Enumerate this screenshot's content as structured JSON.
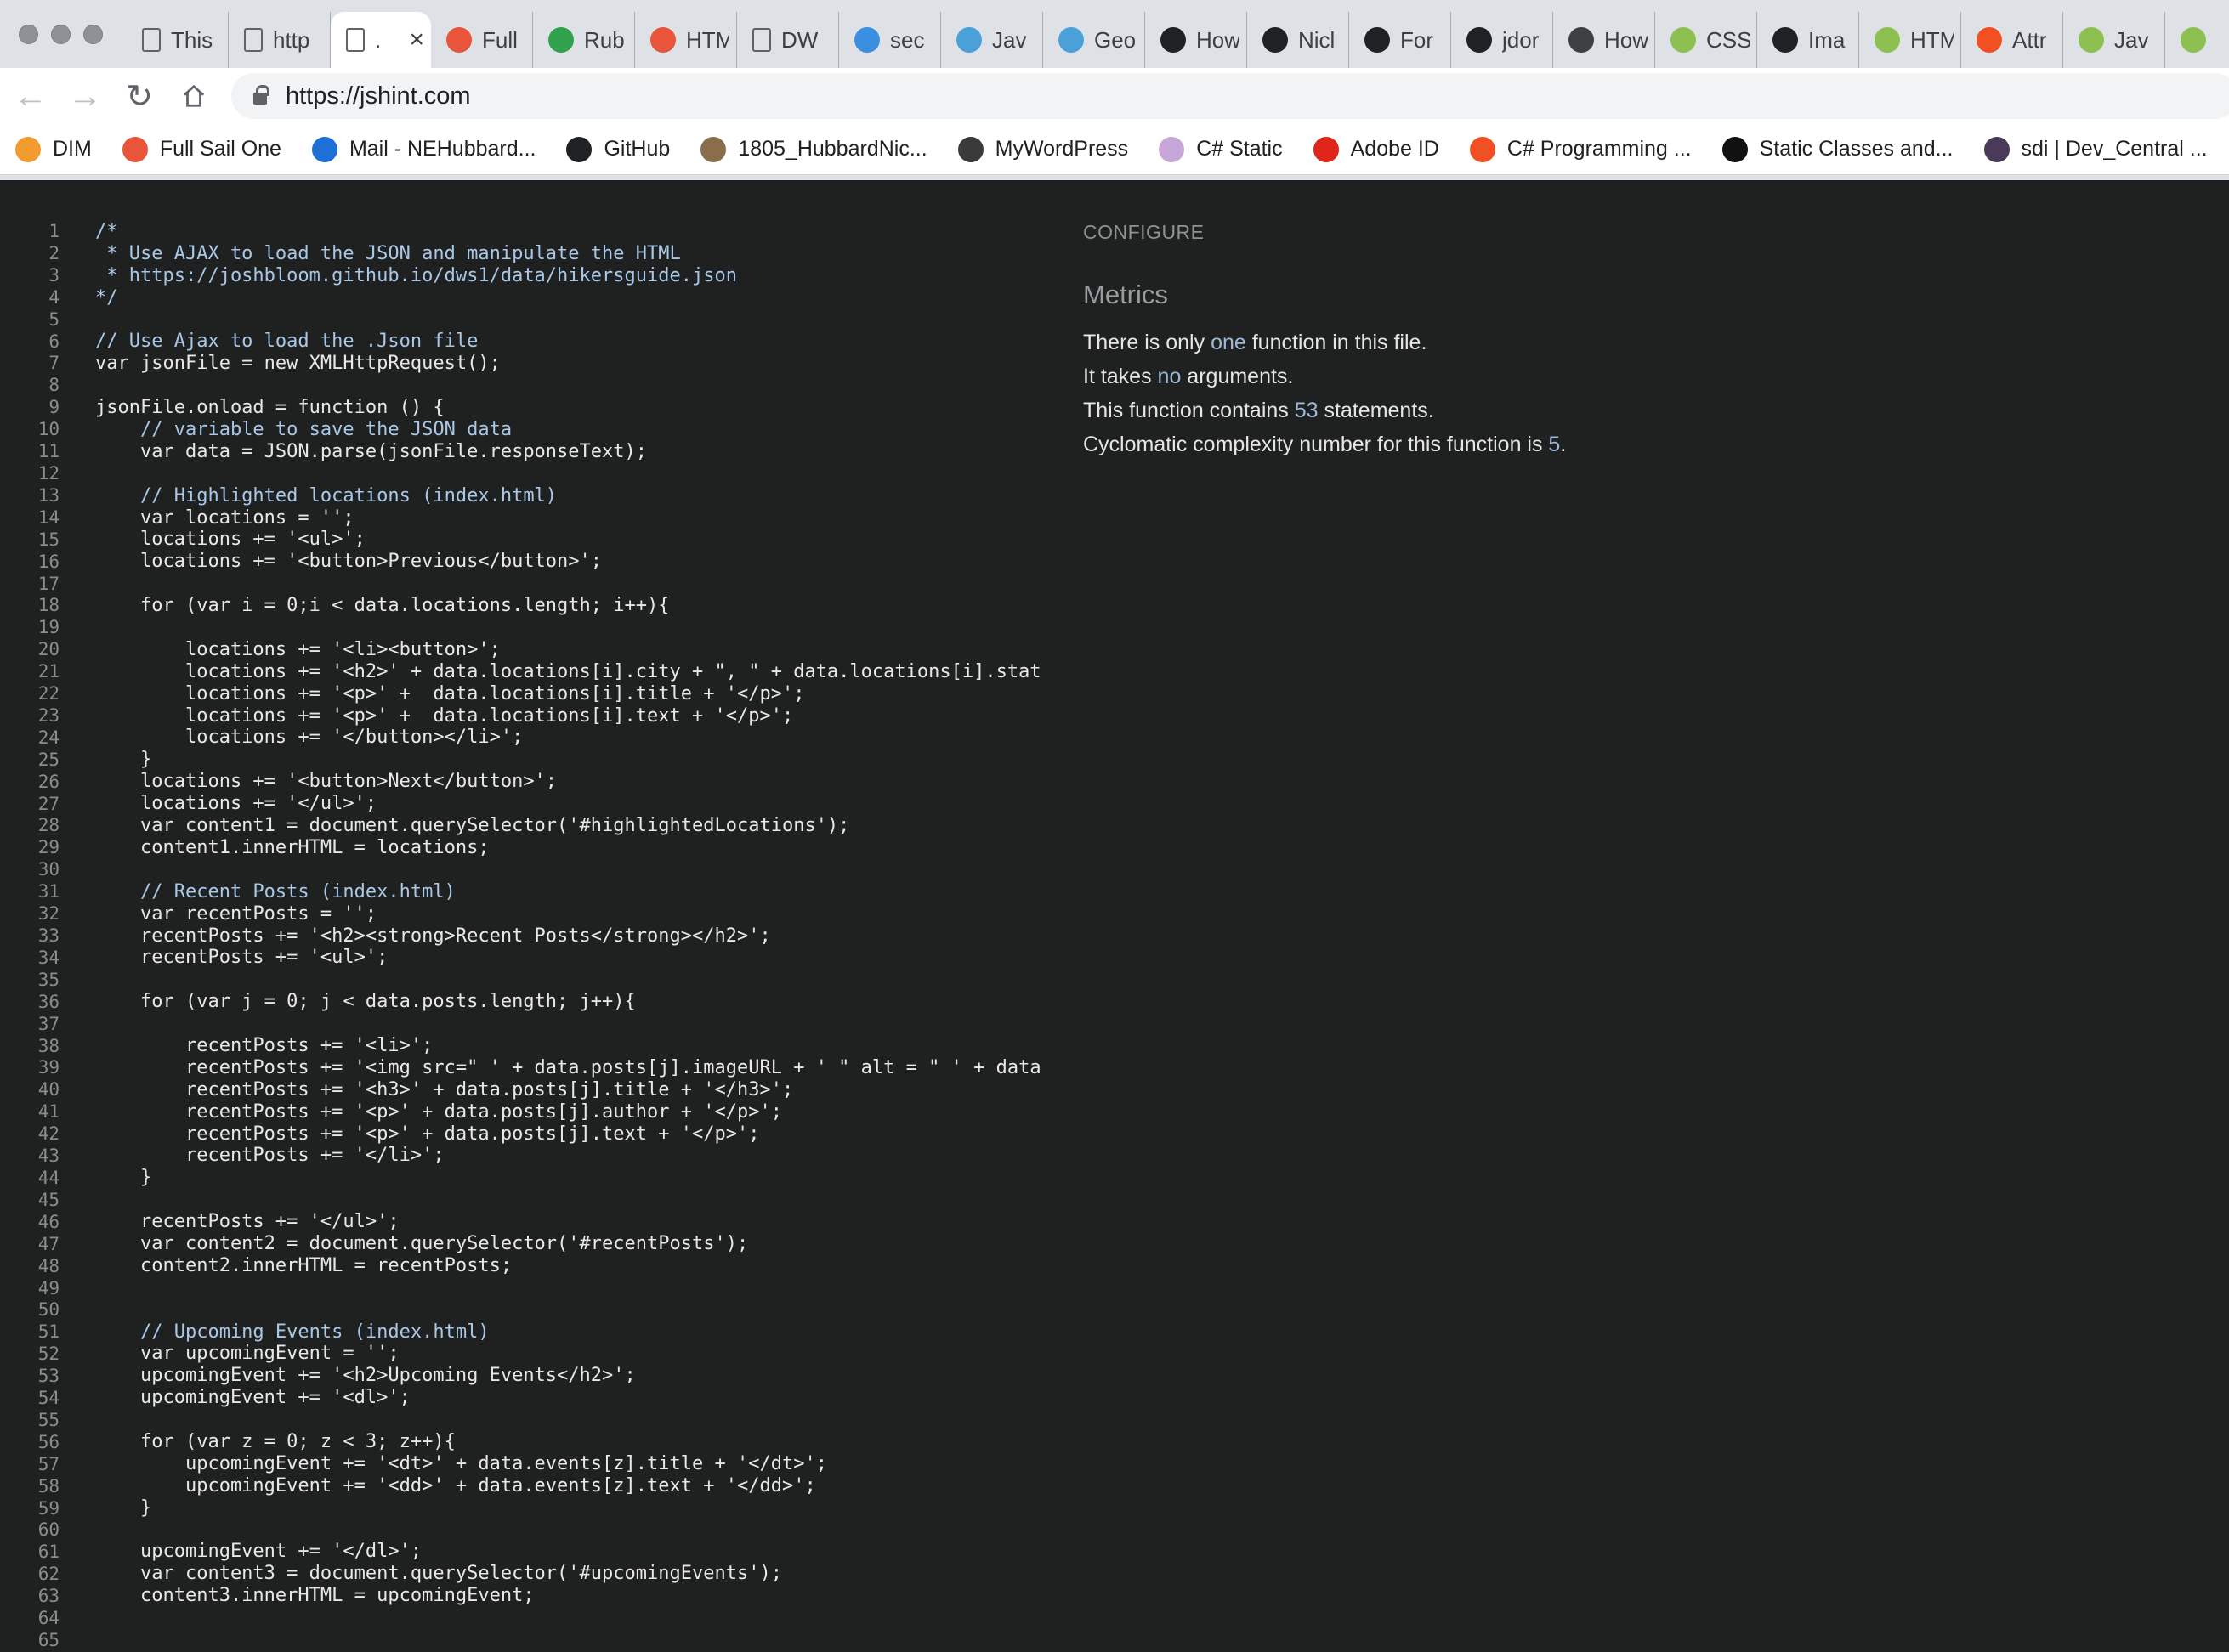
{
  "tabs": [
    {
      "icon": "document-icon",
      "label": "This",
      "color": "#5f6368"
    },
    {
      "icon": "document-icon",
      "label": "http",
      "color": "#5f6368"
    },
    {
      "icon": "document-icon",
      "label": ".",
      "color": "#5f6368",
      "active": true
    },
    {
      "icon": "fullsail-icon",
      "label": "Full",
      "color": "#e8553b"
    },
    {
      "icon": "plus-icon",
      "label": "Rub",
      "color": "#31a24c"
    },
    {
      "icon": "fullsail-icon",
      "label": "HTM",
      "color": "#e8553b"
    },
    {
      "icon": "document-icon",
      "label": "DW",
      "color": "#5f6368"
    },
    {
      "icon": "s-icon",
      "label": "sec",
      "color": "#3b8fe0"
    },
    {
      "icon": "cap-icon",
      "label": "Jav",
      "color": "#4aa0d8"
    },
    {
      "icon": "cap-icon",
      "label": "Geo",
      "color": "#4aa0d8"
    },
    {
      "icon": "codepen-icon",
      "label": "How",
      "color": "#202124"
    },
    {
      "icon": "github-icon",
      "label": "Nicl",
      "color": "#202124"
    },
    {
      "icon": "codepen-icon",
      "label": "For",
      "color": "#202124"
    },
    {
      "icon": "github-icon",
      "label": "jdor",
      "color": "#202124"
    },
    {
      "icon": "stack-icon",
      "label": "How",
      "color": "#3c4043"
    },
    {
      "icon": "w3-icon",
      "label": "CSS",
      "color": "#8cc152"
    },
    {
      "icon": "codepen-icon",
      "label": "Ima",
      "color": "#202124"
    },
    {
      "icon": "w3-icon",
      "label": "HTM",
      "color": "#8cc152"
    },
    {
      "icon": "ms-icon",
      "label": "Attr",
      "color": "#f25022"
    },
    {
      "icon": "w3-icon",
      "label": "Jav",
      "color": "#8cc152"
    },
    {
      "icon": "w3-icon",
      "label": "",
      "color": "#8cc152"
    }
  ],
  "address": {
    "url": "https://jshint.com"
  },
  "bookmarks": [
    {
      "icon": "dim-icon",
      "label": "DIM",
      "color": "#f29b2f"
    },
    {
      "icon": "fullsail-icon",
      "label": "Full Sail One",
      "color": "#e8553b"
    },
    {
      "icon": "outlook-icon",
      "label": "Mail - NEHubbard...",
      "color": "#1e6fd6"
    },
    {
      "icon": "github-icon",
      "label": "GitHub",
      "color": "#202124"
    },
    {
      "icon": "photo-icon",
      "label": "1805_HubbardNic...",
      "color": "#8a6d4a"
    },
    {
      "icon": "photo-icon",
      "label": "MyWordPress",
      "color": "#3a3a3a"
    },
    {
      "icon": "csharp-icon",
      "label": "C# Static",
      "color": "#c7a6d8"
    },
    {
      "icon": "adobe-icon",
      "label": "Adobe ID",
      "color": "#e1251b"
    },
    {
      "icon": "ms-icon",
      "label": "C# Programming ...",
      "color": "#f25022"
    },
    {
      "icon": "m-icon",
      "label": "Static Classes and...",
      "color": "#111111"
    },
    {
      "icon": "hash-icon",
      "label": "sdi | Dev_Central ...",
      "color": "#4a3a5a"
    }
  ],
  "line_numbers": [
    "1",
    "2",
    "3",
    "4",
    "5",
    "6",
    "7",
    "8",
    "9",
    "10",
    "11",
    "12",
    "13",
    "14",
    "15",
    "16",
    "17",
    "18",
    "19",
    "20",
    "21",
    "22",
    "23",
    "24",
    "25",
    "26",
    "27",
    "28",
    "29",
    "30",
    "31",
    "32",
    "33",
    "34",
    "35",
    "36",
    "37",
    "38",
    "39",
    "40",
    "41",
    "42",
    "43",
    "44",
    "45",
    "46",
    "47",
    "48",
    "49",
    "50",
    "51",
    "52",
    "53",
    "54",
    "55",
    "56",
    "57",
    "58",
    "59",
    "60",
    "61",
    "62",
    "63",
    "64",
    "65"
  ],
  "code_lines": [
    "/*",
    " * Use AJAX to load the JSON and manipulate the HTML",
    " * https://joshbloom.github.io/dws1/data/hikersguide.json",
    "*/",
    "",
    "// Use Ajax to load the .Json file",
    "var jsonFile = new XMLHttpRequest();",
    "",
    "jsonFile.onload = function () {",
    "    // variable to save the JSON data",
    "    var data = JSON.parse(jsonFile.responseText);",
    "",
    "    // Highlighted locations (index.html)",
    "    var locations = '';",
    "    locations += '<ul>';",
    "    locations += '<button>Previous</button>';",
    "",
    "    for (var i = 0;i < data.locations.length; i++){",
    "",
    "        locations += '<li><button>';",
    "        locations += '<h2>' + data.locations[i].city + \", \" + data.locations[i].stat",
    "        locations += '<p>' +  data.locations[i].title + '</p>';",
    "        locations += '<p>' +  data.locations[i].text + '</p>';",
    "        locations += '</button></li>';",
    "    }",
    "    locations += '<button>Next</button>';",
    "    locations += '</ul>';",
    "    var content1 = document.querySelector('#highlightedLocations');",
    "    content1.innerHTML = locations;",
    "",
    "    // Recent Posts (index.html)",
    "    var recentPosts = '';",
    "    recentPosts += '<h2><strong>Recent Posts</strong></h2>';",
    "    recentPosts += '<ul>';",
    "",
    "    for (var j = 0; j < data.posts.length; j++){",
    "",
    "        recentPosts += '<li>';",
    "        recentPosts += '<img src=\" ' + data.posts[j].imageURL + ' \" alt = \" ' + data",
    "        recentPosts += '<h3>' + data.posts[j].title + '</h3>';",
    "        recentPosts += '<p>' + data.posts[j].author + '</p>';",
    "        recentPosts += '<p>' + data.posts[j].text + '</p>';",
    "        recentPosts += '</li>';",
    "    }",
    "",
    "    recentPosts += '</ul>';",
    "    var content2 = document.querySelector('#recentPosts');",
    "    content2.innerHTML = recentPosts;",
    "",
    "",
    "    // Upcoming Events (index.html)",
    "    var upcomingEvent = '';",
    "    upcomingEvent += '<h2>Upcoming Events</h2>';",
    "    upcomingEvent += '<dl>';",
    "",
    "    for (var z = 0; z < 3; z++){",
    "        upcomingEvent += '<dt>' + data.events[z].title + '</dt>';",
    "        upcomingEvent += '<dd>' + data.events[z].text + '</dd>';",
    "    }",
    "",
    "    upcomingEvent += '</dl>';",
    "    var content3 = document.querySelector('#upcomingEvents');",
    "    content3.innerHTML = upcomingEvent;",
    "",
    ""
  ],
  "panel": {
    "configure": "CONFIGURE",
    "metrics_title": "Metrics",
    "m1_pre": "There is only ",
    "m1_hl": "one",
    "m1_post": " function in this file.",
    "m2_pre": "It takes ",
    "m2_hl": "no",
    "m2_post": " arguments.",
    "m3_pre": "This function contains ",
    "m3_hl": "53",
    "m3_post": " statements.",
    "m4_pre": "Cyclomatic complexity number for this function is ",
    "m4_hl": "5",
    "m4_post": "."
  }
}
